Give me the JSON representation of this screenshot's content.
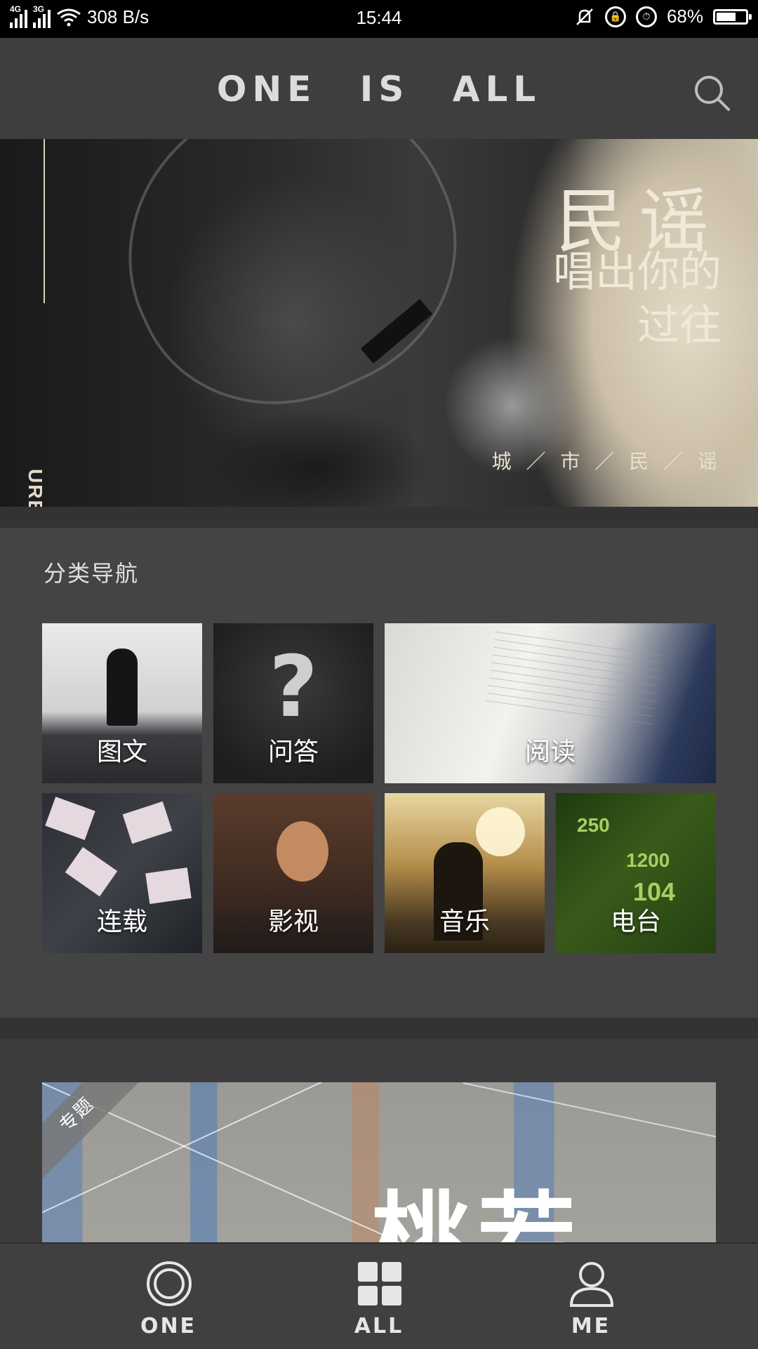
{
  "status_bar": {
    "network_1": "4G",
    "network_2": "3G",
    "speed": "308 B/s",
    "time": "15:44",
    "battery": "68%",
    "battery_level": 0.68
  },
  "header": {
    "title": "ONE  IS  ALL",
    "search_icon": "search-icon"
  },
  "banner": {
    "side_text": "URBAN FOLK",
    "headline": "民谣",
    "subheadline_line1": "唱出你的",
    "subheadline_line2": "过往",
    "tagline": "城 ／ 市 ／ 民 ／ 谣"
  },
  "category_nav": {
    "title": "分类导航",
    "items": [
      {
        "label": "图文"
      },
      {
        "label": "问答"
      },
      {
        "label": "阅读"
      },
      {
        "label": "连载"
      },
      {
        "label": "影视"
      },
      {
        "label": "音乐"
      },
      {
        "label": "电台"
      }
    ]
  },
  "special": {
    "corner_label": "专题",
    "title": "桃若"
  },
  "bottom_nav": {
    "items": [
      {
        "label": "ONE",
        "icon": "one-icon"
      },
      {
        "label": "ALL",
        "icon": "grid-icon"
      },
      {
        "label": "ME",
        "icon": "user-icon"
      }
    ]
  },
  "colors": {
    "background": "#3c3c3c",
    "header_bg": "#3e3e3e",
    "section_bg": "#444444",
    "banner_text": "#f0e8d8"
  }
}
